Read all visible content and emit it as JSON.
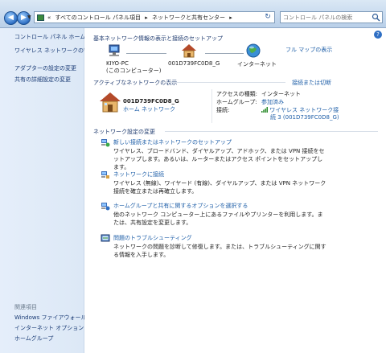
{
  "address": {
    "crumbs": [
      "«",
      "すべてのコントロール パネル項目",
      "▸",
      "ネットワークと共有センター",
      "▸"
    ]
  },
  "search": {
    "placeholder": "コントロール パネルの検索"
  },
  "sidebar": {
    "items": [
      {
        "label": "コントロール パネル ホーム"
      },
      {
        "label": "ワイヤレス ネットワークの管理"
      },
      {
        "label": "アダプターの設定の変更"
      },
      {
        "label": "共有の詳細設定の変更"
      }
    ],
    "see_also_title": "関連項目",
    "see_also": [
      {
        "label": "Windows ファイアウォール"
      },
      {
        "label": "インターネット オプション"
      },
      {
        "label": "ホームグループ"
      }
    ]
  },
  "main": {
    "header": "基本ネットワーク情報の表示と接続のセットアップ",
    "full_map": "フル マップの表示",
    "map": {
      "pc_name": "KIYO-PC",
      "pc_sub": "(このコンピューター)",
      "network": "001D739FC0D8_G",
      "internet": "インターネット"
    },
    "active_header": "アクティブなネットワークの表示",
    "connect_disconnect": "接続または切断",
    "active": {
      "name": "001D739FC0D8_G",
      "type": "ホーム ネットワーク",
      "access_label": "アクセスの種類:",
      "access_value": "インターネット",
      "homegroup_label": "ホームグループ:",
      "homegroup_value": "参加済み",
      "connection_label": "接続:",
      "connection_value_1": "ワイヤレス ネットワーク接",
      "connection_value_2": "続 3 (001D739FC0D8_G)"
    },
    "change_header": "ネットワーク設定の変更",
    "tasks": [
      {
        "title": "新しい接続またはネットワークのセットアップ",
        "desc": "ワイヤレス、ブロードバンド、ダイヤルアップ、アドホック、または VPN 接続をセットアップします。あるいは、ルーターまたはアクセス ポイントをセットアップします。"
      },
      {
        "title": "ネットワークに接続",
        "desc": "ワイヤレス (無線)、ワイヤード (有線)、ダイヤルアップ、または VPN ネットワーク接続を確立または再確立します。"
      },
      {
        "title": "ホームグループと共有に関するオプションを選択する",
        "desc": "他のネットワーク コンピューター上にあるファイルやプリンターを利用します。または、共有設定を変更します。"
      },
      {
        "title": "問題のトラブルシューティング",
        "desc": "ネットワークの問題を診断して修復します。または、トラブルシューティングに関する情報を入手します。"
      }
    ]
  },
  "colors": {
    "link": "#1f5fa8",
    "heading": "#1e3a6e",
    "sidebar_bg": "#dce8f6"
  }
}
